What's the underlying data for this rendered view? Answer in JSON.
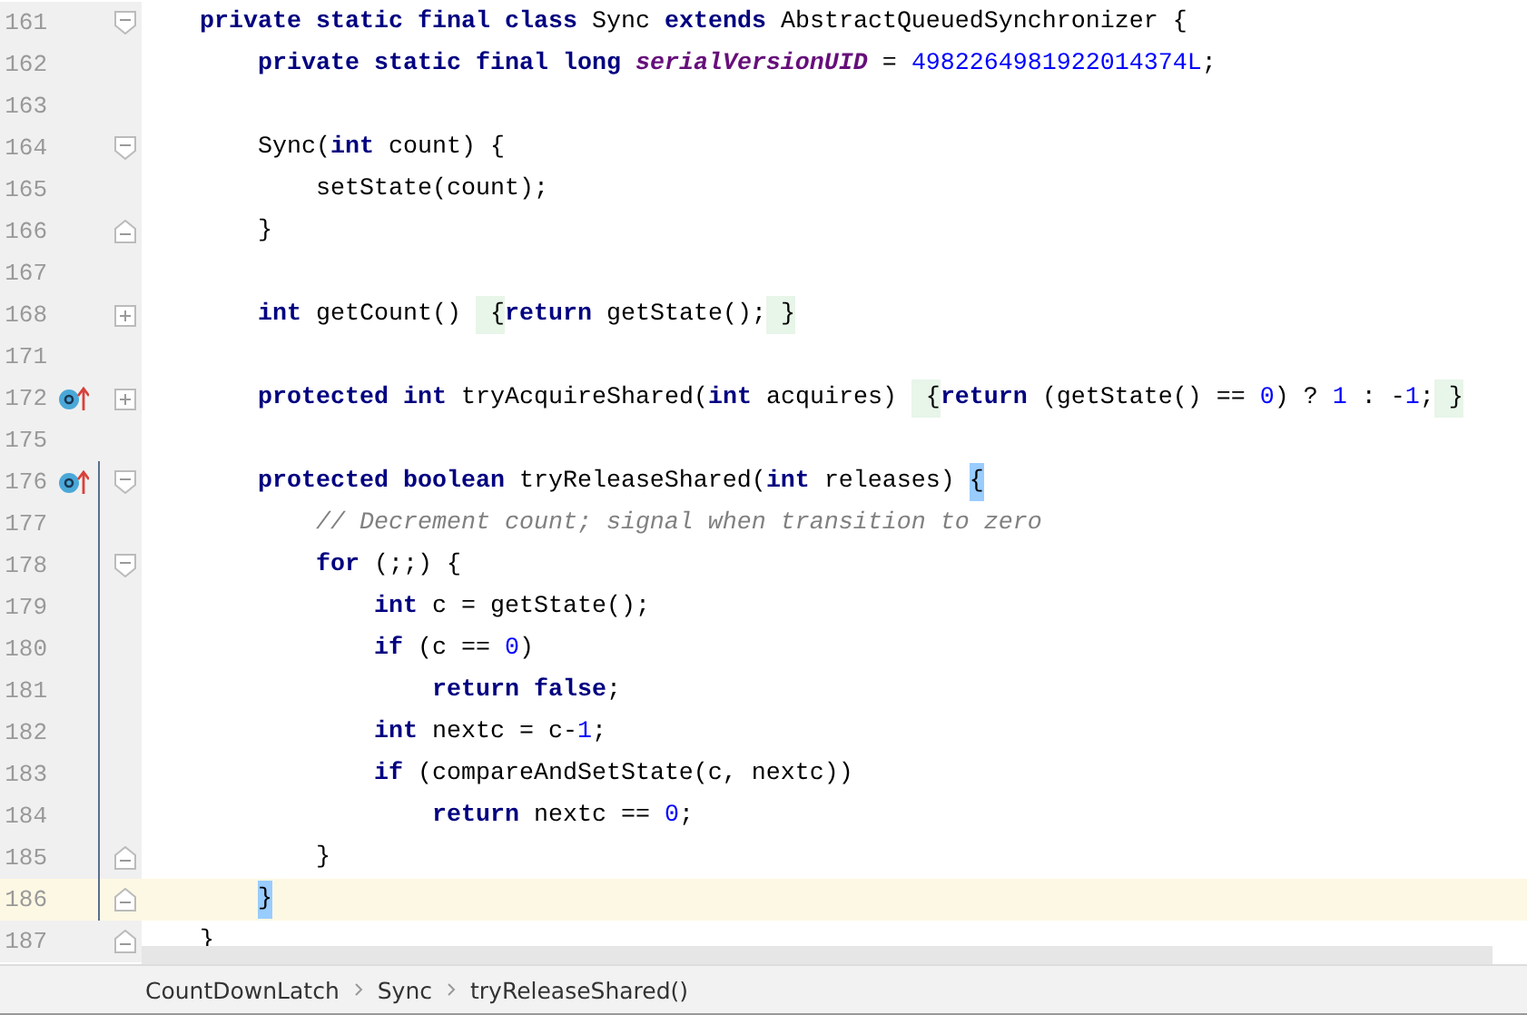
{
  "editor": {
    "lines": [
      {
        "number": "161",
        "fold": {
          "kind": "open"
        },
        "current": false,
        "scope": false,
        "tokens": [
          {
            "kind": "keyword",
            "text": "    private static final class "
          },
          {
            "kind": "plain",
            "text": "Sync "
          },
          {
            "kind": "keyword",
            "text": "extends "
          },
          {
            "kind": "plain",
            "text": "AbstractQueuedSynchronizer {"
          }
        ]
      },
      {
        "number": "162",
        "current": false,
        "scope": false,
        "tokens": [
          {
            "kind": "keyword",
            "text": "        private static final long "
          },
          {
            "kind": "field",
            "text": "serialVersionUID"
          },
          {
            "kind": "plain",
            "text": " = "
          },
          {
            "kind": "number",
            "text": "4982264981922014374L"
          },
          {
            "kind": "plain",
            "text": ";"
          }
        ]
      },
      {
        "number": "163",
        "current": false,
        "scope": false
      },
      {
        "number": "164",
        "fold": {
          "kind": "open"
        },
        "current": false,
        "scope": false,
        "tokens": [
          {
            "kind": "plain",
            "text": "        Sync("
          },
          {
            "kind": "keyword",
            "text": "int "
          },
          {
            "kind": "plain",
            "text": "count) {"
          }
        ]
      },
      {
        "number": "165",
        "current": false,
        "scope": false,
        "tokens": [
          {
            "kind": "plain",
            "text": "            setState(count);"
          }
        ]
      },
      {
        "number": "166",
        "fold": {
          "kind": "close"
        },
        "current": false,
        "scope": false,
        "tokens": [
          {
            "kind": "plain",
            "text": "        }"
          }
        ]
      },
      {
        "number": "167",
        "current": false,
        "scope": false
      },
      {
        "number": "168",
        "fold": {
          "kind": "collapsed"
        },
        "current": false,
        "scope": false,
        "tokens": [
          {
            "kind": "keyword",
            "text": "        int "
          },
          {
            "kind": "plain",
            "text": "getCount() "
          },
          {
            "kind": "folded",
            "text": " {"
          },
          {
            "kind": "keyword",
            "text": "return "
          },
          {
            "kind": "plain",
            "text": "getState();"
          },
          {
            "kind": "folded",
            "text": " }"
          }
        ]
      },
      {
        "number": "171",
        "current": false,
        "scope": false
      },
      {
        "number": "172",
        "fold": {
          "kind": "collapsed"
        },
        "marker": {
          "kind": "override"
        },
        "current": false,
        "scope": false,
        "tokens": [
          {
            "kind": "keyword",
            "text": "        protected int "
          },
          {
            "kind": "plain",
            "text": "tryAcquireShared("
          },
          {
            "kind": "keyword",
            "text": "int "
          },
          {
            "kind": "plain",
            "text": "acquires) "
          },
          {
            "kind": "folded",
            "text": " {"
          },
          {
            "kind": "keyword",
            "text": "return "
          },
          {
            "kind": "plain",
            "text": "(getState() == "
          },
          {
            "kind": "number",
            "text": "0"
          },
          {
            "kind": "plain",
            "text": ") ? "
          },
          {
            "kind": "number",
            "text": "1"
          },
          {
            "kind": "plain",
            "text": " : -"
          },
          {
            "kind": "number",
            "text": "1"
          },
          {
            "kind": "plain",
            "text": ";"
          },
          {
            "kind": "folded",
            "text": " }"
          }
        ]
      },
      {
        "number": "175",
        "current": false,
        "scope": false
      },
      {
        "number": "176",
        "fold": {
          "kind": "open"
        },
        "marker": {
          "kind": "override"
        },
        "current": false,
        "scope": true,
        "tokens": [
          {
            "kind": "keyword",
            "text": "        protected boolean "
          },
          {
            "kind": "plain",
            "text": "tryReleaseShared("
          },
          {
            "kind": "keyword",
            "text": "int "
          },
          {
            "kind": "plain",
            "text": "releases) "
          },
          {
            "kind": "match",
            "text": "{"
          }
        ]
      },
      {
        "number": "177",
        "current": false,
        "scope": true,
        "tokens": [
          {
            "kind": "comment",
            "text": "            // Decrement count; signal when transition to zero"
          }
        ]
      },
      {
        "number": "178",
        "fold": {
          "kind": "open"
        },
        "current": false,
        "scope": true,
        "tokens": [
          {
            "kind": "keyword",
            "text": "            for "
          },
          {
            "kind": "plain",
            "text": "(;;) {"
          }
        ]
      },
      {
        "number": "179",
        "current": false,
        "scope": true,
        "tokens": [
          {
            "kind": "keyword",
            "text": "                int "
          },
          {
            "kind": "plain",
            "text": "c = getState();"
          }
        ]
      },
      {
        "number": "180",
        "current": false,
        "scope": true,
        "tokens": [
          {
            "kind": "keyword",
            "text": "                if "
          },
          {
            "kind": "plain",
            "text": "(c == "
          },
          {
            "kind": "number",
            "text": "0"
          },
          {
            "kind": "plain",
            "text": ")"
          }
        ]
      },
      {
        "number": "181",
        "current": false,
        "scope": true,
        "tokens": [
          {
            "kind": "keyword",
            "text": "                    return false"
          },
          {
            "kind": "plain",
            "text": ";"
          }
        ]
      },
      {
        "number": "182",
        "current": false,
        "scope": true,
        "tokens": [
          {
            "kind": "keyword",
            "text": "                int "
          },
          {
            "kind": "plain",
            "text": "nextc = c-"
          },
          {
            "kind": "number",
            "text": "1"
          },
          {
            "kind": "plain",
            "text": ";"
          }
        ]
      },
      {
        "number": "183",
        "current": false,
        "scope": true,
        "tokens": [
          {
            "kind": "keyword",
            "text": "                if "
          },
          {
            "kind": "plain",
            "text": "(compareAndSetState(c, nextc))"
          }
        ]
      },
      {
        "number": "184",
        "current": false,
        "scope": true,
        "tokens": [
          {
            "kind": "keyword",
            "text": "                    return "
          },
          {
            "kind": "plain",
            "text": "nextc == "
          },
          {
            "kind": "number",
            "text": "0"
          },
          {
            "kind": "plain",
            "text": ";"
          }
        ]
      },
      {
        "number": "185",
        "fold": {
          "kind": "close"
        },
        "current": false,
        "scope": true,
        "tokens": [
          {
            "kind": "plain",
            "text": "            }"
          }
        ]
      },
      {
        "number": "186",
        "fold": {
          "kind": "close"
        },
        "current": true,
        "scope": true,
        "tokens": [
          {
            "kind": "match",
            "text": "        }"
          }
        ]
      },
      {
        "number": "187",
        "fold": {
          "kind": "close"
        },
        "current": false,
        "scope": false,
        "tokens": [
          {
            "kind": "plain",
            "text": "    }"
          }
        ]
      }
    ]
  },
  "breadcrumbs": [
    "CountDownLatch",
    "Sync",
    "tryReleaseShared()"
  ]
}
